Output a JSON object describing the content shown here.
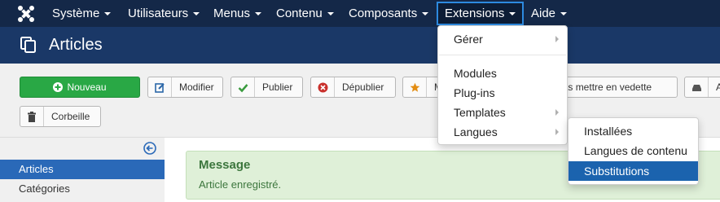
{
  "navbar": {
    "menus": [
      "Système",
      "Utilisateurs",
      "Menus",
      "Contenu",
      "Composants",
      "Extensions",
      "Aide"
    ]
  },
  "header": {
    "title": "Articles"
  },
  "toolbar": {
    "new_label": "Nouveau",
    "edit_label": "Modifier",
    "publish_label": "Publier",
    "unpublish_label": "Dépublier",
    "feature_label": "M",
    "unfeature_label": "e pas mettre en vedette",
    "archive_label": "A",
    "trash_label": "Corbeille"
  },
  "sidebar": {
    "items": [
      {
        "label": "Articles",
        "active": true
      },
      {
        "label": "Catégories",
        "active": false
      }
    ]
  },
  "message": {
    "title": "Message",
    "text": "Article enregistré."
  },
  "extensions_menu": {
    "items": [
      "Gérer",
      "Modules",
      "Plug-ins",
      "Templates",
      "Langues"
    ]
  },
  "languages_submenu": {
    "items": [
      "Installées",
      "Langues de contenu",
      "Substitutions"
    ],
    "selected": "Substitutions"
  },
  "colors": {
    "navbar": "#142848",
    "header": "#1a3867",
    "new_button": "#29a845",
    "selected": "#1b63ae",
    "success_bg": "#dff0d8"
  }
}
